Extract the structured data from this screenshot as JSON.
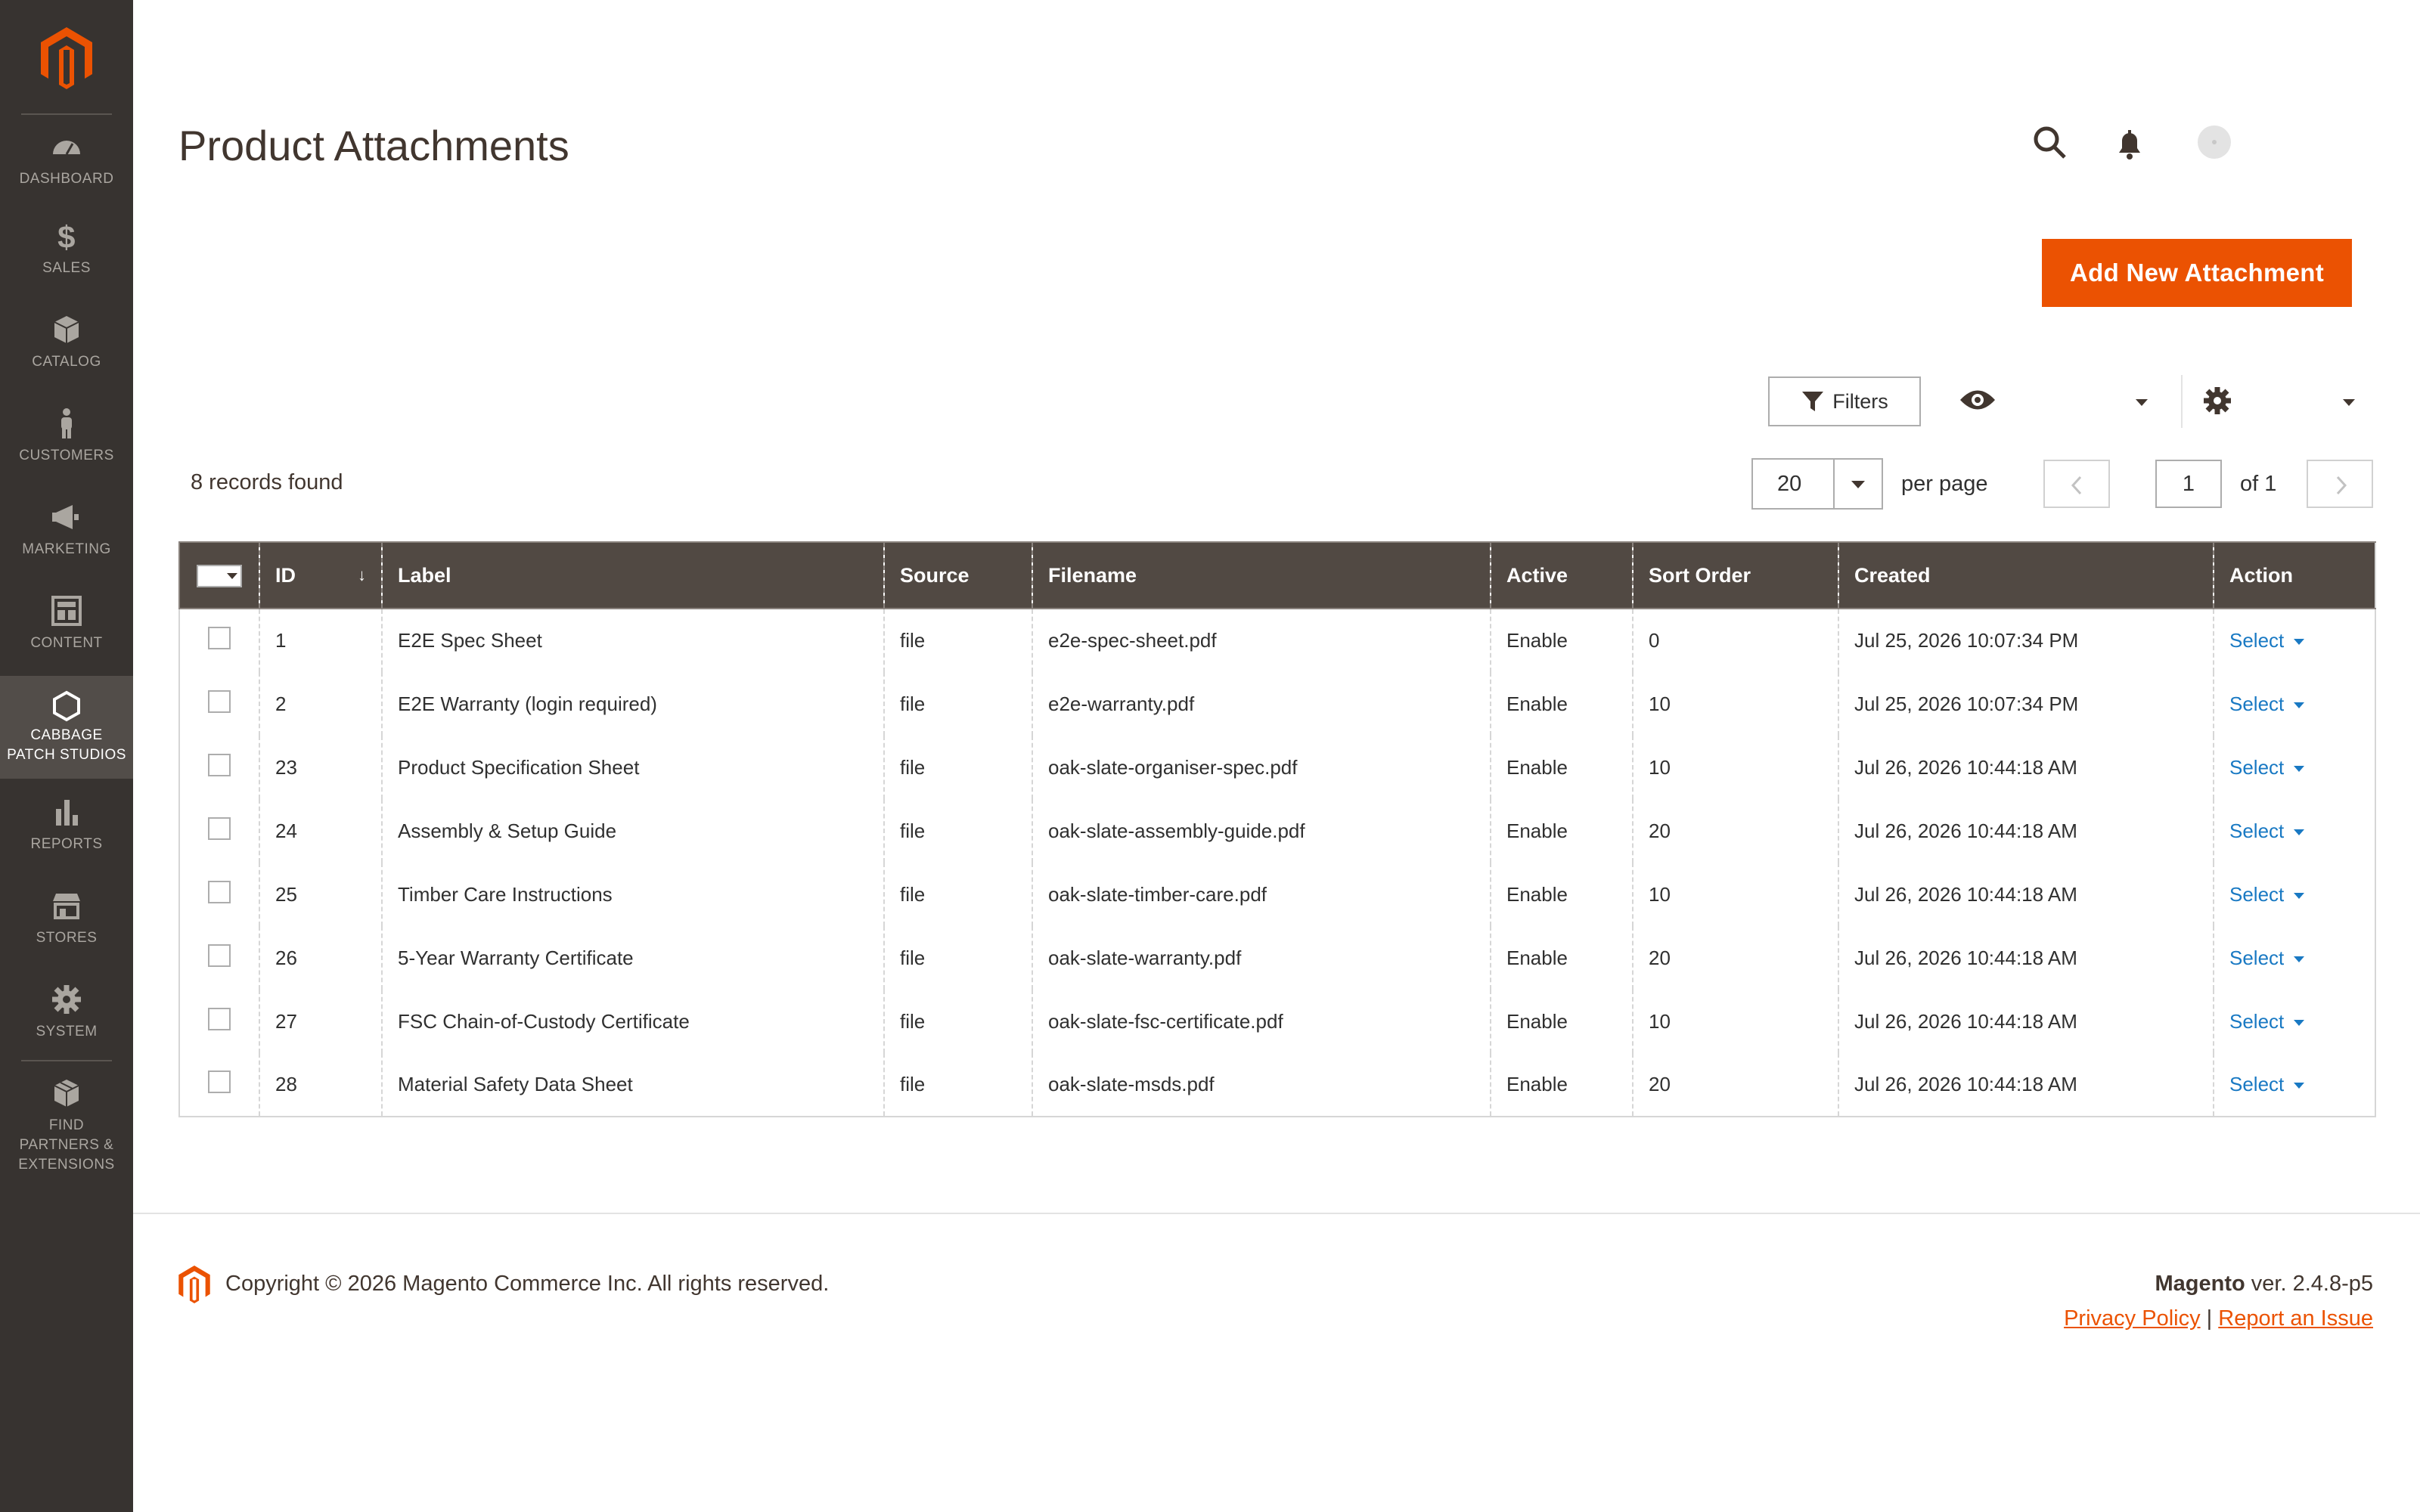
{
  "sidebar": {
    "items": [
      {
        "label": "DASHBOARD",
        "icon": "dashboard-icon"
      },
      {
        "label": "SALES",
        "icon": "dollar-icon"
      },
      {
        "label": "CATALOG",
        "icon": "cube-icon"
      },
      {
        "label": "CUSTOMERS",
        "icon": "person-icon"
      },
      {
        "label": "MARKETING",
        "icon": "megaphone-icon"
      },
      {
        "label": "CONTENT",
        "icon": "layout-icon"
      },
      {
        "label_line1": "CABBAGE",
        "label_line2": "PATCH STUDIOS",
        "icon": "hexagon-icon"
      },
      {
        "label": "REPORTS",
        "icon": "bar-chart-icon"
      },
      {
        "label": "STORES",
        "icon": "store-icon"
      },
      {
        "label": "SYSTEM",
        "icon": "gear-icon"
      },
      {
        "label_line1": "FIND",
        "label_line2": "PARTNERS &",
        "label_line3": "EXTENSIONS",
        "icon": "box-icon"
      }
    ]
  },
  "header": {
    "title": "Product Attachments",
    "add_button": "Add New Attachment"
  },
  "toolbar": {
    "filters_label": "Filters",
    "records_found": "8 records found",
    "per_page_value": "20",
    "per_page_label": "per page",
    "current_page": "1",
    "of_pages": "of 1"
  },
  "grid": {
    "columns": [
      "ID",
      "Label",
      "Source",
      "Filename",
      "Active",
      "Sort Order",
      "Created",
      "Action"
    ],
    "rows": [
      {
        "id": "1",
        "label": "E2E Spec Sheet",
        "source": "file",
        "filename": "e2e-spec-sheet.pdf",
        "active": "Enable",
        "sort": "0",
        "created": "Jul 25, 2026 10:07:34 PM",
        "action": "Select"
      },
      {
        "id": "2",
        "label": "E2E Warranty (login required)",
        "source": "file",
        "filename": "e2e-warranty.pdf",
        "active": "Enable",
        "sort": "10",
        "created": "Jul 25, 2026 10:07:34 PM",
        "action": "Select"
      },
      {
        "id": "23",
        "label": "Product Specification Sheet",
        "source": "file",
        "filename": "oak-slate-organiser-spec.pdf",
        "active": "Enable",
        "sort": "10",
        "created": "Jul 26, 2026 10:44:18 AM",
        "action": "Select"
      },
      {
        "id": "24",
        "label": "Assembly & Setup Guide",
        "source": "file",
        "filename": "oak-slate-assembly-guide.pdf",
        "active": "Enable",
        "sort": "20",
        "created": "Jul 26, 2026 10:44:18 AM",
        "action": "Select"
      },
      {
        "id": "25",
        "label": "Timber Care Instructions",
        "source": "file",
        "filename": "oak-slate-timber-care.pdf",
        "active": "Enable",
        "sort": "10",
        "created": "Jul 26, 2026 10:44:18 AM",
        "action": "Select"
      },
      {
        "id": "26",
        "label": "5-Year Warranty Certificate",
        "source": "file",
        "filename": "oak-slate-warranty.pdf",
        "active": "Enable",
        "sort": "20",
        "created": "Jul 26, 2026 10:44:18 AM",
        "action": "Select"
      },
      {
        "id": "27",
        "label": "FSC Chain-of-Custody Certificate",
        "source": "file",
        "filename": "oak-slate-fsc-certificate.pdf",
        "active": "Enable",
        "sort": "10",
        "created": "Jul 26, 2026 10:44:18 AM",
        "action": "Select"
      },
      {
        "id": "28",
        "label": "Material Safety Data Sheet",
        "source": "file",
        "filename": "oak-slate-msds.pdf",
        "active": "Enable",
        "sort": "20",
        "created": "Jul 26, 2026 10:44:18 AM",
        "action": "Select"
      }
    ]
  },
  "footer": {
    "copyright": "Copyright © 2026 Magento Commerce Inc. All rights reserved.",
    "brand": "Magento",
    "version": " ver. 2.4.8-p5",
    "privacy": "Privacy Policy",
    "separator": "|",
    "report": "Report an Issue"
  },
  "colors": {
    "accent": "#eb5202",
    "sidebar_bg": "#373330",
    "header_bg": "#514943",
    "link": "#1979c3"
  }
}
